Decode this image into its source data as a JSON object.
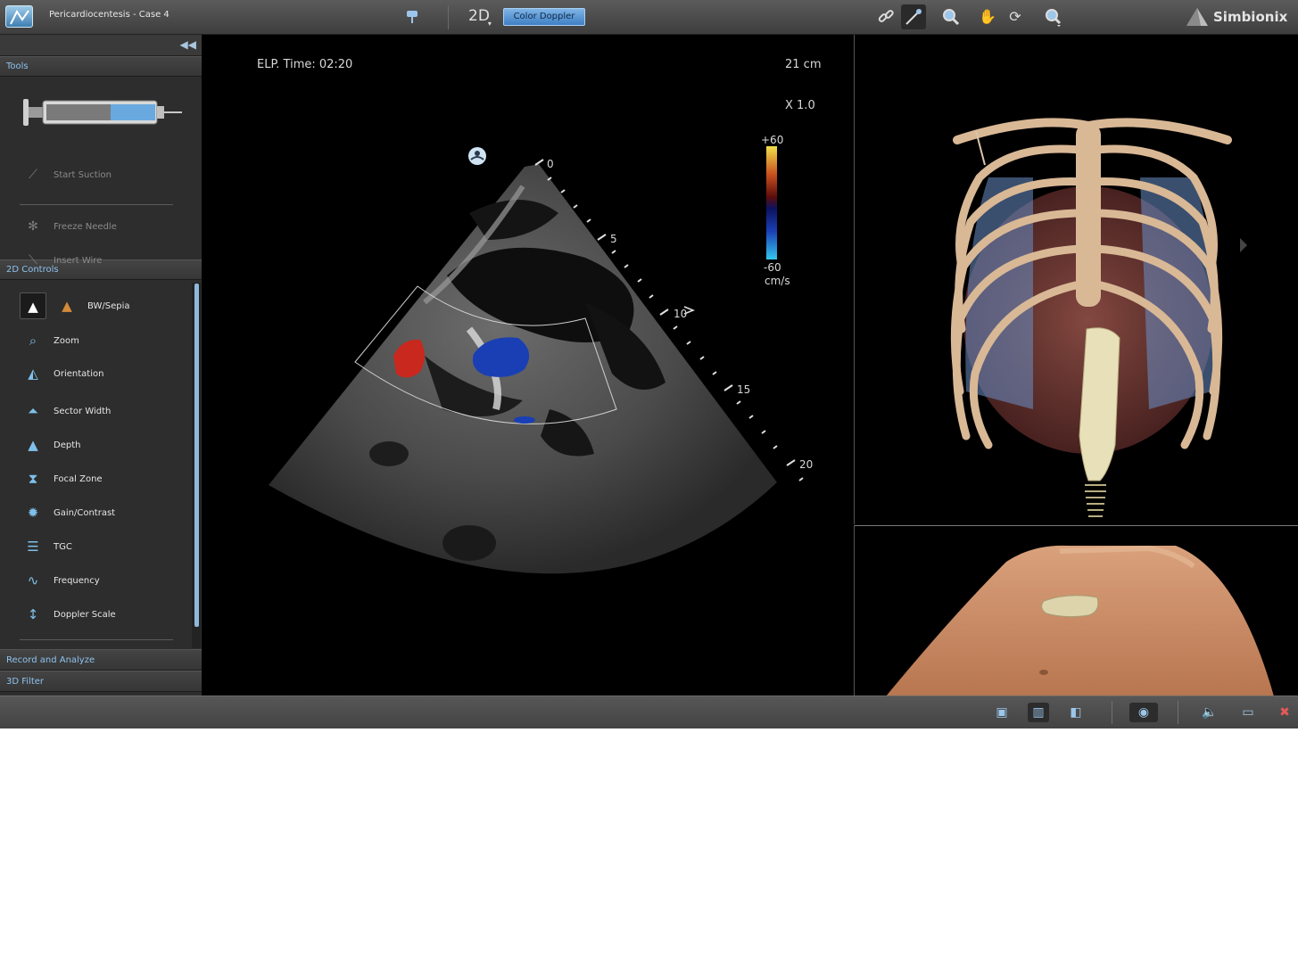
{
  "window": {
    "case_title": "Pericardiocentesis - Case 4",
    "brand": "Simbionix",
    "mode_2d": "2D",
    "color_doppler": "Color Doppler"
  },
  "toolbar_icons": [
    "pin-icon",
    "link-icon",
    "needle-link-icon",
    "zoom-icon",
    "pan-hand-icon",
    "rotate-icon",
    "zoom-dropdown-icon"
  ],
  "sidebar": {
    "tools_header": "Tools",
    "tools": [
      {
        "label": "Start Suction",
        "icon": "suction-icon"
      },
      {
        "label": "Freeze Needle",
        "icon": "snowflake-icon"
      },
      {
        "label": "Insert Wire",
        "icon": "wire-icon"
      }
    ],
    "controls_header": "2D Controls",
    "controls": [
      {
        "label": "BW/Sepia",
        "icon": "bw-sepia-icon"
      },
      {
        "label": "Zoom",
        "icon": "zoom-icon"
      },
      {
        "label": "Orientation",
        "icon": "orientation-icon"
      },
      {
        "label": "Sector Width",
        "icon": "sector-width-icon"
      },
      {
        "label": "Depth",
        "icon": "depth-icon"
      },
      {
        "label": "Focal Zone",
        "icon": "focal-zone-icon"
      },
      {
        "label": "Gain/Contrast",
        "icon": "gain-contrast-icon"
      },
      {
        "label": "TGC",
        "icon": "tgc-icon"
      },
      {
        "label": "Frequency",
        "icon": "frequency-icon"
      },
      {
        "label": "Doppler Scale",
        "icon": "doppler-scale-icon"
      }
    ],
    "record_header": "Record and Analyze",
    "filter_header": "3D Filter"
  },
  "ultrasound": {
    "elapsed_time": "ELP. Time: 02:20",
    "depth_cm": "21 cm",
    "zoom_level": "X 1.0",
    "scale_max": "+60",
    "scale_min": "-60",
    "scale_unit": "cm/s",
    "depth_ticks": [
      "0",
      "5",
      "10",
      "15",
      "20"
    ]
  },
  "colors": {
    "accent": "#8ec3ef",
    "doppler_button": "#5a9ad6",
    "doppler_positive": "#c8281e",
    "doppler_negative": "#1a3fb4"
  },
  "bottom_icons": [
    "view-single-icon",
    "view-split-icon",
    "view-anatomy-icon",
    "camera-icon",
    "sound-icon",
    "open-folder-icon",
    "close-icon"
  ]
}
